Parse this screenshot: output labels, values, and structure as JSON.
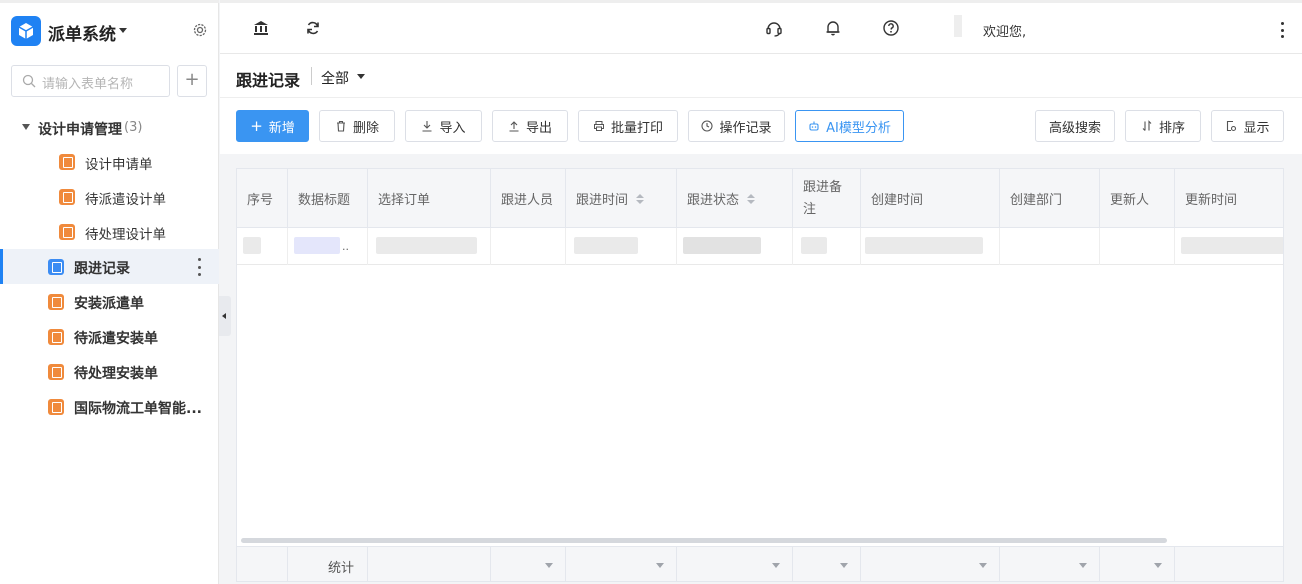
{
  "app": {
    "title": "派单系统"
  },
  "sidebar": {
    "search_placeholder": "请输入表单名称",
    "add_label": "+",
    "group": {
      "label": "设计申请管理",
      "count": "(3)"
    },
    "sub_items": [
      {
        "label": "设计申请单"
      },
      {
        "label": "待派遣设计单"
      },
      {
        "label": "待处理设计单"
      }
    ],
    "items": [
      {
        "label": "跟进记录",
        "active": true
      },
      {
        "label": "安装派遣单"
      },
      {
        "label": "待派遣安装单"
      },
      {
        "label": "待处理安装单"
      },
      {
        "label": "国际物流工单智能..."
      }
    ]
  },
  "header": {
    "welcome": "欢迎您,",
    "icons": [
      "bank-icon",
      "refresh-icon",
      "headset-icon",
      "bell-icon",
      "help-icon",
      "more-icon"
    ]
  },
  "page": {
    "title": "跟进记录",
    "filter": "全部"
  },
  "toolbar": {
    "new": "新增",
    "delete": "删除",
    "import": "导入",
    "export": "导出",
    "batch_print": "批量打印",
    "op_log": "操作记录",
    "ai": "AI模型分析",
    "advanced_search": "高级搜索",
    "sort": "排序",
    "display": "显示"
  },
  "table": {
    "columns": [
      {
        "label": "序号"
      },
      {
        "label": "数据标题"
      },
      {
        "label": "选择订单"
      },
      {
        "label": "跟进人员"
      },
      {
        "label": "跟进时间",
        "sortable": true
      },
      {
        "label": "跟进状态",
        "sortable": true
      },
      {
        "label": "跟进备注"
      },
      {
        "label": "创建时间"
      },
      {
        "label": "创建部门"
      },
      {
        "label": "更新人"
      },
      {
        "label": "更新时间"
      }
    ],
    "row_title_suffix": "..",
    "footer_label": "统计"
  },
  "colors": {
    "primary": "#3a95f2",
    "accent_orange": "#f08a3c",
    "sidebar_active_bg": "#eef2f8"
  }
}
